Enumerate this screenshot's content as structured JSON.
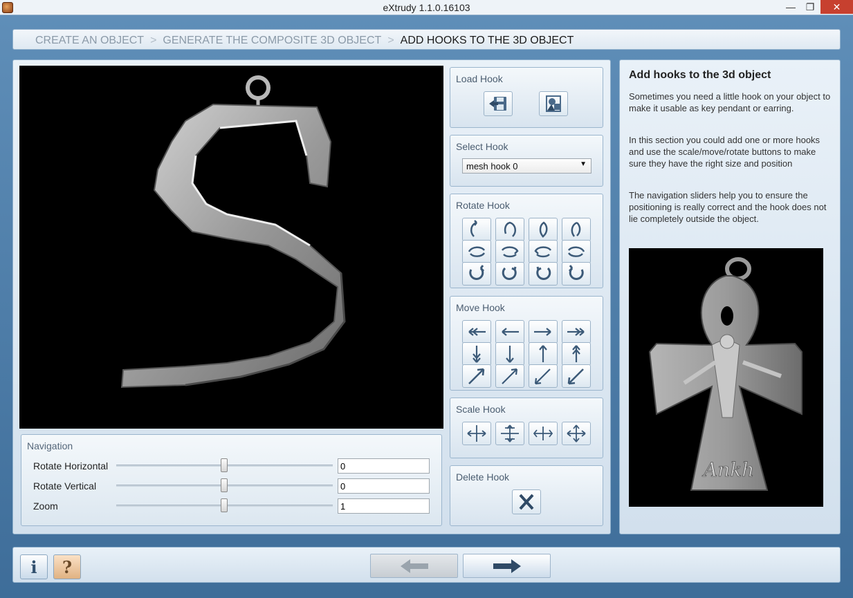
{
  "window": {
    "title": "eXtrudy 1.1.0.16103"
  },
  "breadcrumb": [
    {
      "label": "CREATE AN OBJECT",
      "active": false
    },
    {
      "label": "GENERATE THE COMPOSITE 3D OBJECT",
      "active": false
    },
    {
      "label": "ADD HOOKS TO THE 3D OBJECT",
      "active": true
    }
  ],
  "breadcrumb_separator": ">",
  "navigation": {
    "title": "Navigation",
    "rows": [
      {
        "label": "Rotate Horizontal",
        "value": "0"
      },
      {
        "label": "Rotate Vertical",
        "value": "0"
      },
      {
        "label": "Zoom",
        "value": "1"
      }
    ]
  },
  "tools": {
    "load_hook": {
      "title": "Load Hook",
      "buttons": [
        "load-from-file-icon",
        "load-shape-icon"
      ]
    },
    "select_hook": {
      "title": "Select Hook",
      "selected": "mesh hook 0"
    },
    "rotate_hook": {
      "title": "Rotate Hook"
    },
    "move_hook": {
      "title": "Move Hook"
    },
    "scale_hook": {
      "title": "Scale Hook"
    },
    "delete_hook": {
      "title": "Delete Hook"
    }
  },
  "info": {
    "heading": "Add hooks to the 3d object",
    "paragraphs": [
      "Sometimes you need a little hook on your object to make it usable as key pendant or earring.",
      "In this section you could add one or more hooks and use the scale/move/rotate buttons to make sure they have the right size and position",
      "The navigation sliders help you to ensure the positioning is really correct and the hook does not lie completely outside the object."
    ]
  },
  "preview": {
    "engraving": "Ankh"
  },
  "colors": {
    "accent": "#3c5a78",
    "background": "#4a7aa6",
    "close": "#c7402f"
  }
}
